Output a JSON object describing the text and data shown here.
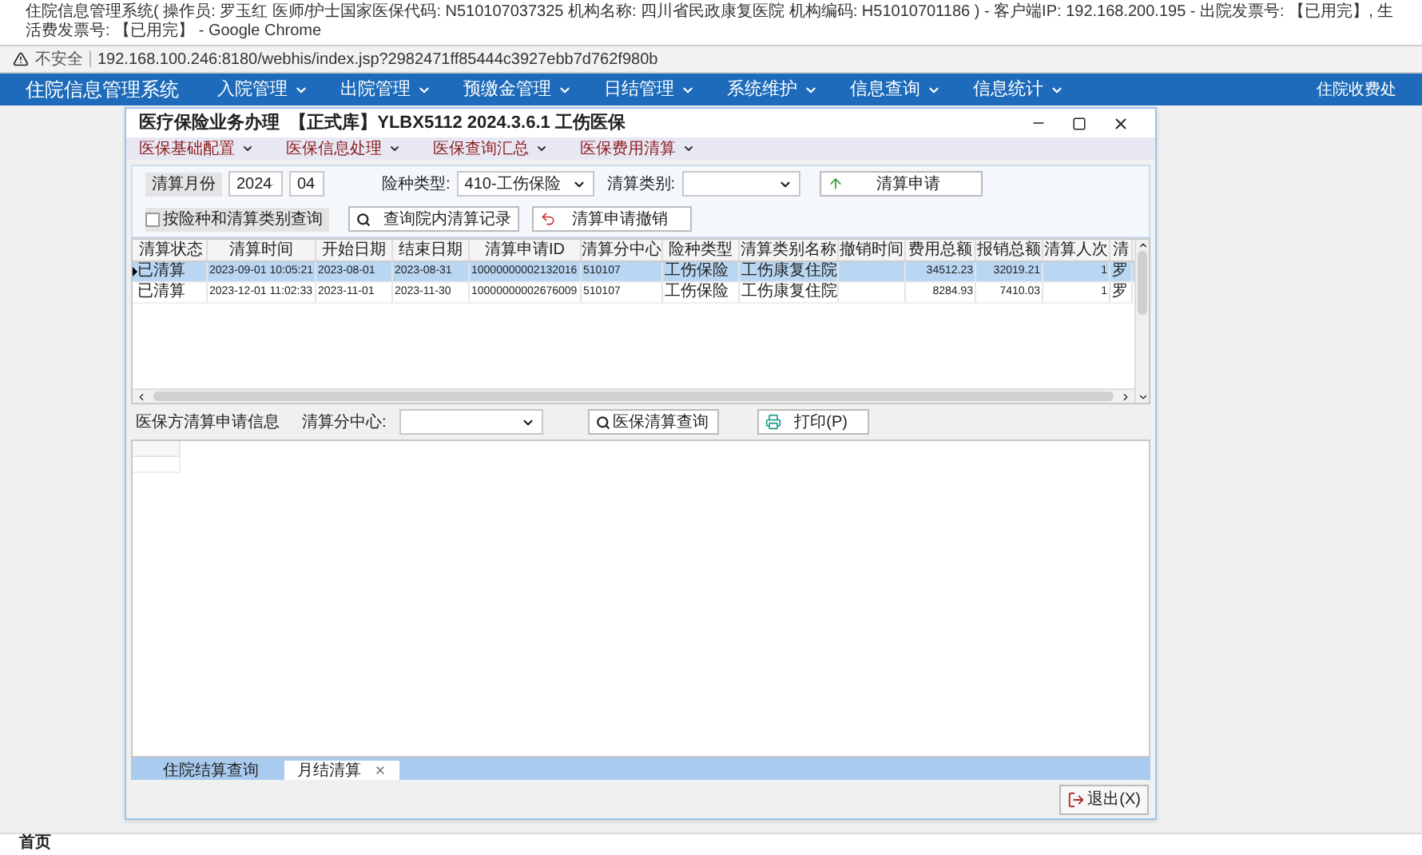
{
  "browser": {
    "title": "住院信息管理系统( 操作员: 罗玉红  医师/护士国家医保代码: N510107037325  机构名称: 四川省民政康复医院  机构编码: H51010701186 ) - 客户端IP: 192.168.200.195 - 出院发票号: 【已用完】, 生活费发票号: 【已用完】 - Google Chrome",
    "security": "不安全",
    "url": "192.168.100.246:8180/webhis/index.jsp?2982471ff85444c3927ebb7d762f980b"
  },
  "app": {
    "title": "住院信息管理系统",
    "nav": [
      "入院管理",
      "出院管理",
      "预缴金管理",
      "日结管理",
      "系统维护",
      "信息查询",
      "信息统计"
    ],
    "location": "住院收费处",
    "home_tab": "首页"
  },
  "dialog": {
    "title": "医疗保险业务办理  【正式库】YLBX5112 2024.3.6.1 工伤医保",
    "menus": [
      "医保基础配置",
      "医保信息处理",
      "医保查询汇总",
      "医保费用清算"
    ],
    "filters": {
      "month_label": "清算月份",
      "year": "2024",
      "month": "04",
      "insurance_label": "险种类型:",
      "insurance": "410-工伤保险",
      "category_label": "清算类别:"
    },
    "apply_button": "清算申请",
    "query_checkbox": {
      "label": "按险种和清算类别查询",
      "checked": false
    },
    "query_button": "查询院内清算记录",
    "revoke_button": "清算申请撤销",
    "table": {
      "columns": [
        "清算状态",
        "清算时间",
        "开始日期",
        "结束日期",
        "清算申请ID",
        "清算分中心",
        "险种类型",
        "清算类别名称",
        "撤销时间",
        "费用总额",
        "报销总额",
        "清算人次",
        "清"
      ],
      "rows": [
        {
          "selected": true,
          "cells": [
            "已清算",
            "2023-09-01 10:05:21",
            "2023-08-01",
            "2023-08-31",
            "10000000002132016",
            "510107",
            "工伤保险",
            "工伤康复住院",
            null,
            "34512.23",
            "32019.21",
            "1",
            "罗"
          ]
        },
        {
          "selected": false,
          "cells": [
            "已清算",
            "2023-12-01 11:02:33",
            "2023-11-01",
            "2023-11-30",
            "10000000002676009",
            "510107",
            "工伤保险",
            "工伤康复住院",
            null,
            "8284.93",
            "7410.03",
            "1",
            "罗"
          ]
        }
      ]
    },
    "lower": {
      "label": "医保方清算申请信息",
      "center_label": "清算分中心:",
      "query_button": "医保清算查询",
      "print_button": "打印(P)"
    },
    "tabs": [
      {
        "label": "住院结算查询",
        "selected": false
      },
      {
        "label": "月结清算",
        "selected": true
      }
    ],
    "exit_button": "退出(X)"
  }
}
